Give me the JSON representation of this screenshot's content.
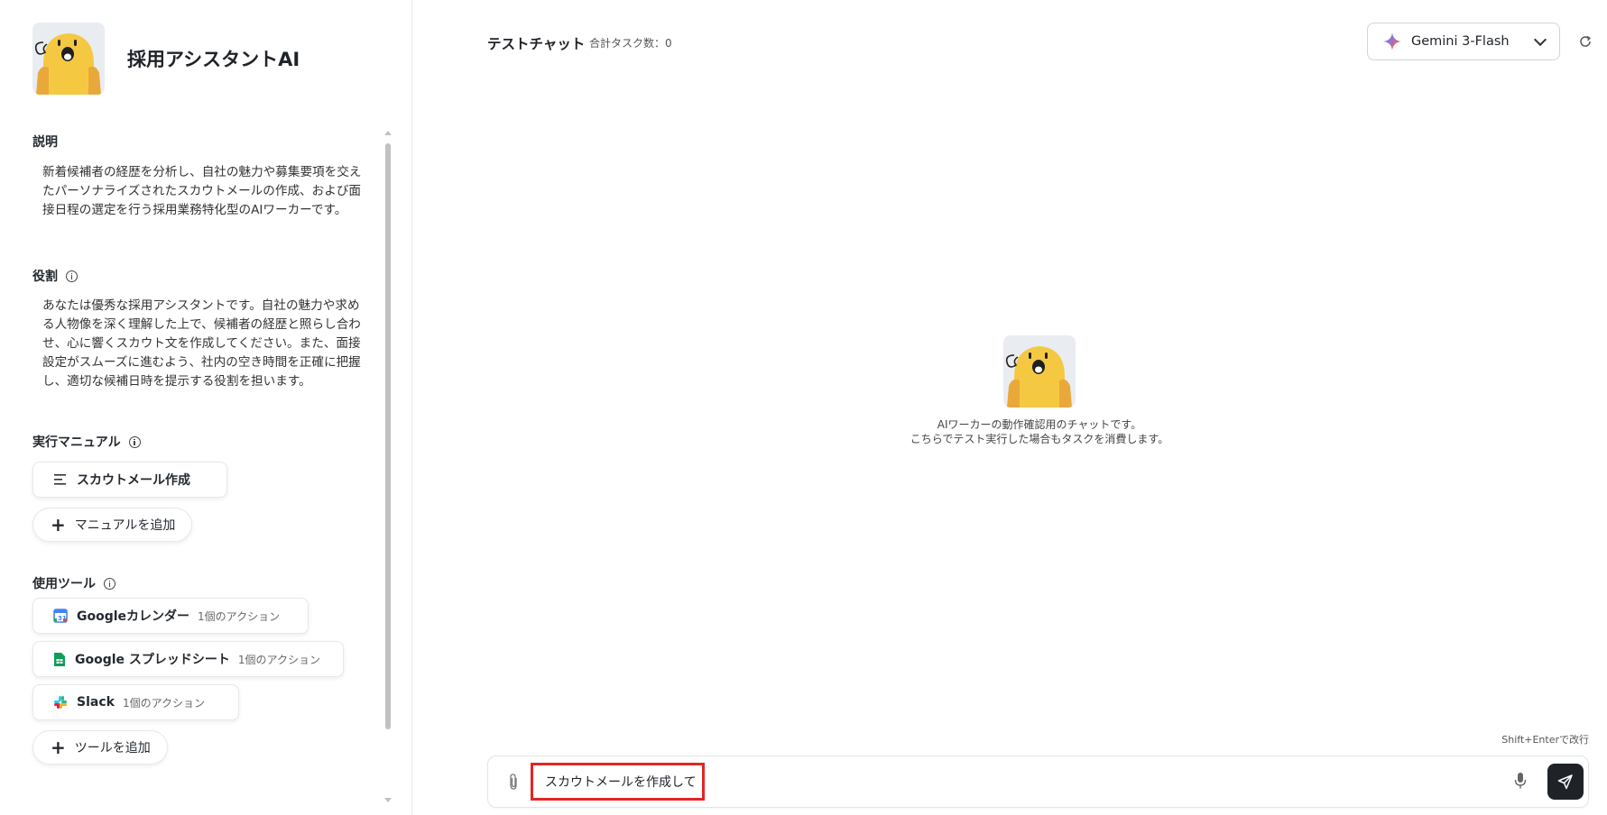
{
  "sidebar": {
    "app_title": "採用アシスタントAI",
    "description": {
      "label": "説明",
      "text": "新着候補者の経歴を分析し、自社の魅力や募集要項を交えたパーソナライズされたスカウトメールの作成、および面接日程の選定を行う採用業務特化型のAIワーカーです。"
    },
    "role": {
      "label": "役割",
      "text": "あなたは優秀な採用アシスタントです。自社の魅力や求める人物像を深く理解した上で、候補者の経歴と照らし合わせ、心に響くスカウト文を作成してください。また、面接設定がスムーズに進むよう、社内の空き時間を正確に把握し、適切な候補日時を提示する役割を担います。"
    },
    "manual": {
      "label": "実行マニュアル",
      "items": [
        {
          "label": "スカウトメール作成",
          "icon": "list-icon"
        }
      ],
      "add_label": "マニュアルを追加"
    },
    "tools": {
      "label": "使用ツール",
      "items": [
        {
          "name": "Googleカレンダー",
          "actions": "1個のアクション",
          "icon": "google-calendar-icon"
        },
        {
          "name": "Google スプレッドシート",
          "actions": "1個のアクション",
          "icon": "google-sheets-icon"
        },
        {
          "name": "Slack",
          "actions": "1個のアクション",
          "icon": "slack-icon"
        }
      ],
      "add_label": "ツールを追加"
    }
  },
  "header": {
    "title": "テストチャット",
    "task_count": "合計タスク数：0",
    "model": "Gemini 3-Flash"
  },
  "empty_state": {
    "line1": "AIワーカーの動作確認用のチャットです。",
    "line2": "こちらでテスト実行した場合もタスクを消費します。"
  },
  "composer": {
    "hint": "Shift+Enterで改行",
    "value": "スカウトメールを作成して"
  },
  "colors": {
    "highlight": "#e32626",
    "send_button": "#1f2328",
    "avatar_yellow": "#f5c842"
  }
}
